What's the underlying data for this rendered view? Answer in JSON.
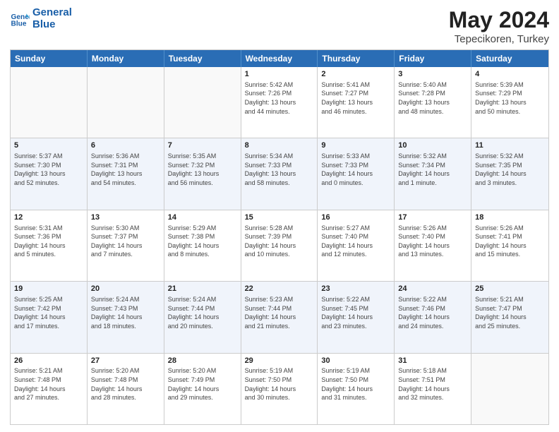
{
  "logo": {
    "line1": "General",
    "line2": "Blue"
  },
  "title": "May 2024",
  "subtitle": "Tepecikoren, Turkey",
  "header_days": [
    "Sunday",
    "Monday",
    "Tuesday",
    "Wednesday",
    "Thursday",
    "Friday",
    "Saturday"
  ],
  "rows": [
    {
      "alt": false,
      "cells": [
        {
          "day": "",
          "info": ""
        },
        {
          "day": "",
          "info": ""
        },
        {
          "day": "",
          "info": ""
        },
        {
          "day": "1",
          "info": "Sunrise: 5:42 AM\nSunset: 7:26 PM\nDaylight: 13 hours\nand 44 minutes."
        },
        {
          "day": "2",
          "info": "Sunrise: 5:41 AM\nSunset: 7:27 PM\nDaylight: 13 hours\nand 46 minutes."
        },
        {
          "day": "3",
          "info": "Sunrise: 5:40 AM\nSunset: 7:28 PM\nDaylight: 13 hours\nand 48 minutes."
        },
        {
          "day": "4",
          "info": "Sunrise: 5:39 AM\nSunset: 7:29 PM\nDaylight: 13 hours\nand 50 minutes."
        }
      ]
    },
    {
      "alt": true,
      "cells": [
        {
          "day": "5",
          "info": "Sunrise: 5:37 AM\nSunset: 7:30 PM\nDaylight: 13 hours\nand 52 minutes."
        },
        {
          "day": "6",
          "info": "Sunrise: 5:36 AM\nSunset: 7:31 PM\nDaylight: 13 hours\nand 54 minutes."
        },
        {
          "day": "7",
          "info": "Sunrise: 5:35 AM\nSunset: 7:32 PM\nDaylight: 13 hours\nand 56 minutes."
        },
        {
          "day": "8",
          "info": "Sunrise: 5:34 AM\nSunset: 7:33 PM\nDaylight: 13 hours\nand 58 minutes."
        },
        {
          "day": "9",
          "info": "Sunrise: 5:33 AM\nSunset: 7:33 PM\nDaylight: 14 hours\nand 0 minutes."
        },
        {
          "day": "10",
          "info": "Sunrise: 5:32 AM\nSunset: 7:34 PM\nDaylight: 14 hours\nand 1 minute."
        },
        {
          "day": "11",
          "info": "Sunrise: 5:32 AM\nSunset: 7:35 PM\nDaylight: 14 hours\nand 3 minutes."
        }
      ]
    },
    {
      "alt": false,
      "cells": [
        {
          "day": "12",
          "info": "Sunrise: 5:31 AM\nSunset: 7:36 PM\nDaylight: 14 hours\nand 5 minutes."
        },
        {
          "day": "13",
          "info": "Sunrise: 5:30 AM\nSunset: 7:37 PM\nDaylight: 14 hours\nand 7 minutes."
        },
        {
          "day": "14",
          "info": "Sunrise: 5:29 AM\nSunset: 7:38 PM\nDaylight: 14 hours\nand 8 minutes."
        },
        {
          "day": "15",
          "info": "Sunrise: 5:28 AM\nSunset: 7:39 PM\nDaylight: 14 hours\nand 10 minutes."
        },
        {
          "day": "16",
          "info": "Sunrise: 5:27 AM\nSunset: 7:40 PM\nDaylight: 14 hours\nand 12 minutes."
        },
        {
          "day": "17",
          "info": "Sunrise: 5:26 AM\nSunset: 7:40 PM\nDaylight: 14 hours\nand 13 minutes."
        },
        {
          "day": "18",
          "info": "Sunrise: 5:26 AM\nSunset: 7:41 PM\nDaylight: 14 hours\nand 15 minutes."
        }
      ]
    },
    {
      "alt": true,
      "cells": [
        {
          "day": "19",
          "info": "Sunrise: 5:25 AM\nSunset: 7:42 PM\nDaylight: 14 hours\nand 17 minutes."
        },
        {
          "day": "20",
          "info": "Sunrise: 5:24 AM\nSunset: 7:43 PM\nDaylight: 14 hours\nand 18 minutes."
        },
        {
          "day": "21",
          "info": "Sunrise: 5:24 AM\nSunset: 7:44 PM\nDaylight: 14 hours\nand 20 minutes."
        },
        {
          "day": "22",
          "info": "Sunrise: 5:23 AM\nSunset: 7:44 PM\nDaylight: 14 hours\nand 21 minutes."
        },
        {
          "day": "23",
          "info": "Sunrise: 5:22 AM\nSunset: 7:45 PM\nDaylight: 14 hours\nand 23 minutes."
        },
        {
          "day": "24",
          "info": "Sunrise: 5:22 AM\nSunset: 7:46 PM\nDaylight: 14 hours\nand 24 minutes."
        },
        {
          "day": "25",
          "info": "Sunrise: 5:21 AM\nSunset: 7:47 PM\nDaylight: 14 hours\nand 25 minutes."
        }
      ]
    },
    {
      "alt": false,
      "cells": [
        {
          "day": "26",
          "info": "Sunrise: 5:21 AM\nSunset: 7:48 PM\nDaylight: 14 hours\nand 27 minutes."
        },
        {
          "day": "27",
          "info": "Sunrise: 5:20 AM\nSunset: 7:48 PM\nDaylight: 14 hours\nand 28 minutes."
        },
        {
          "day": "28",
          "info": "Sunrise: 5:20 AM\nSunset: 7:49 PM\nDaylight: 14 hours\nand 29 minutes."
        },
        {
          "day": "29",
          "info": "Sunrise: 5:19 AM\nSunset: 7:50 PM\nDaylight: 14 hours\nand 30 minutes."
        },
        {
          "day": "30",
          "info": "Sunrise: 5:19 AM\nSunset: 7:50 PM\nDaylight: 14 hours\nand 31 minutes."
        },
        {
          "day": "31",
          "info": "Sunrise: 5:18 AM\nSunset: 7:51 PM\nDaylight: 14 hours\nand 32 minutes."
        },
        {
          "day": "",
          "info": ""
        }
      ]
    }
  ]
}
